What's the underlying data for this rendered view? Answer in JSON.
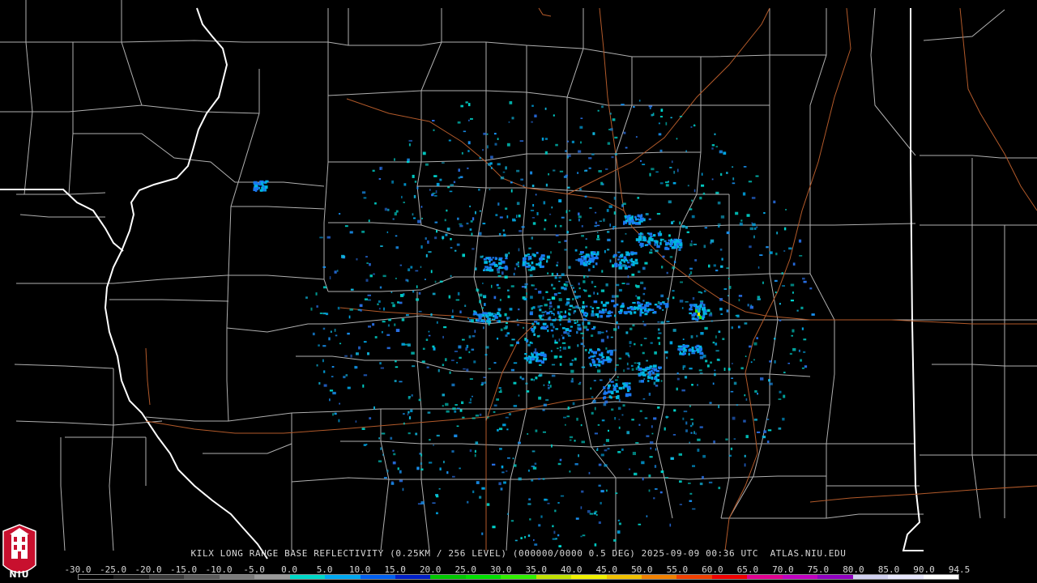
{
  "caption": {
    "product": "KILX LONG RANGE BASE REFLECTIVITY (0.25KM / 256 LEVEL) (000000/0000 0.5 DEG) 2025-09-09 00:36 UTC  ATLAS.NIU.EDU"
  },
  "scale": {
    "labels": [
      "-30.0",
      "-25.0",
      "-20.0",
      "-15.0",
      "-10.0",
      "-5.0",
      "0.0",
      "5.0",
      "10.0",
      "15.0",
      "20.0",
      "25.0",
      "30.0",
      "35.0",
      "40.0",
      "45.0",
      "50.0",
      "55.0",
      "60.0",
      "65.0",
      "70.0",
      "75.0",
      "80.0",
      "85.0",
      "90.0",
      "94.5"
    ],
    "colors": [
      "#000000",
      "#1a1a1a",
      "#3a3a3a",
      "#5a5a5a",
      "#7a7a7a",
      "#9a9a9a",
      "#00d8c8",
      "#00a8f0",
      "#0060f0",
      "#0020c8",
      "#00c800",
      "#00e000",
      "#30f000",
      "#c0e000",
      "#f0f000",
      "#f0c000",
      "#f08000",
      "#f04000",
      "#f00000",
      "#e00090",
      "#c000c0",
      "#9000c0",
      "#d0d0f0",
      "#e8e8ff",
      "#ffffff"
    ]
  },
  "logo": {
    "text": "NIU",
    "colors": {
      "background": "#c8102e",
      "fill": "#ffffff"
    }
  },
  "map": {
    "background": "#000000",
    "county_line_color": "#ffffff",
    "state_line_color": "#ffffff",
    "highway_color": "#b35a2a"
  }
}
